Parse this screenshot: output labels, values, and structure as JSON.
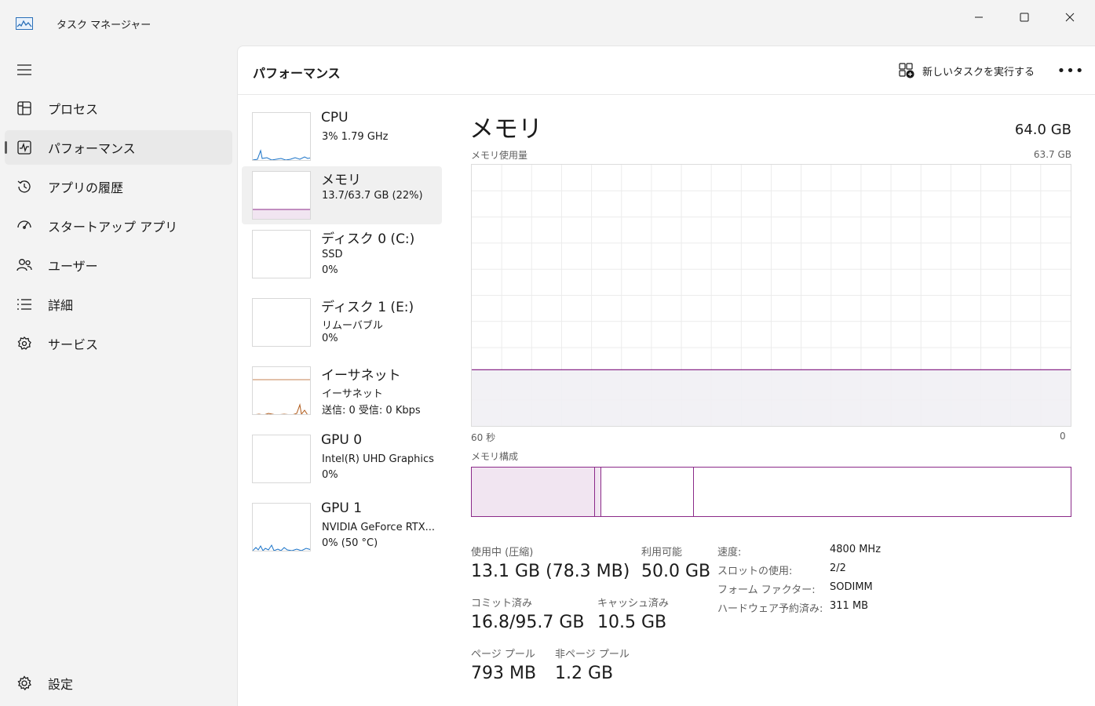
{
  "window": {
    "title": "タスク マネージャー",
    "icons": {
      "app": "performance-graph-icon",
      "minimize": "minimize-icon",
      "maximize": "maximize-icon",
      "close": "close-icon"
    }
  },
  "sidebar": {
    "menu_icon": "hamburger-icon",
    "items": [
      {
        "label": "プロセス",
        "icon": "processes-icon",
        "selected": false
      },
      {
        "label": "パフォーマンス",
        "icon": "performance-icon",
        "selected": true
      },
      {
        "label": "アプリの履歴",
        "icon": "history-icon",
        "selected": false
      },
      {
        "label": "スタートアップ アプリ",
        "icon": "startup-icon",
        "selected": false
      },
      {
        "label": "ユーザー",
        "icon": "users-icon",
        "selected": false
      },
      {
        "label": "詳細",
        "icon": "details-icon",
        "selected": false
      },
      {
        "label": "サービス",
        "icon": "services-icon",
        "selected": false
      }
    ],
    "settings": {
      "label": "設定",
      "icon": "gear-icon"
    }
  },
  "header": {
    "title": "パフォーマンス",
    "new_task_label": "新しいタスクを実行する",
    "new_task_icon": "new-task-icon",
    "more_label": "•••"
  },
  "devices": [
    {
      "name": "CPU",
      "lines": [
        "3%  1.79 GHz"
      ],
      "selected": false
    },
    {
      "name": "メモリ",
      "lines": [
        "13.7/63.7 GB (22%)"
      ],
      "selected": true
    },
    {
      "name": "ディスク 0 (C:)",
      "lines": [
        "SSD",
        "0%"
      ],
      "selected": false
    },
    {
      "name": "ディスク 1 (E:)",
      "lines": [
        "リムーバブル",
        "0%"
      ],
      "selected": false
    },
    {
      "name": "イーサネット",
      "lines": [
        "イーサネット",
        "送信: 0  受信: 0 Kbps"
      ],
      "selected": false
    },
    {
      "name": "GPU 0",
      "lines": [
        "Intel(R) UHD Graphics",
        "0%"
      ],
      "selected": false
    },
    {
      "name": "GPU 1",
      "lines": [
        "NVIDIA GeForce RTX...",
        "0%  (50 °C)"
      ],
      "selected": false
    }
  ],
  "detail": {
    "title": "メモリ",
    "total": "64.0 GB",
    "usage_label": "メモリ使用量",
    "usage_max": "63.7 GB",
    "axis_left": "60 秒",
    "axis_right": "0",
    "composition_label": "メモリ構成",
    "usage_level": 0.215,
    "composition": {
      "in_use": 0.206,
      "modified": 0.01,
      "standby": 0.155
    },
    "colors": {
      "accent": "#8b2a89",
      "fill": "#f1f0f4",
      "grid": "#ececec",
      "bar_fill": "#f1e5f1"
    },
    "stats": {
      "in_use_label": "使用中 (圧縮)",
      "in_use_value": "13.1 GB (78.3 MB)",
      "available_label": "利用可能",
      "available_value": "50.0 GB",
      "committed_label": "コミット済み",
      "committed_value": "16.8/95.7 GB",
      "cached_label": "キャッシュ済み",
      "cached_value": "10.5 GB",
      "paged_label": "ページ プール",
      "paged_value": "793 MB",
      "nonpaged_label": "非ページ プール",
      "nonpaged_value": "1.2 GB"
    },
    "props": [
      {
        "key": "速度:",
        "value": "4800 MHz"
      },
      {
        "key": "スロットの使用:",
        "value": "2/2"
      },
      {
        "key": "フォーム ファクター:",
        "value": "SODIMM"
      },
      {
        "key": "ハードウェア予約済み:",
        "value": "311 MB"
      }
    ]
  }
}
